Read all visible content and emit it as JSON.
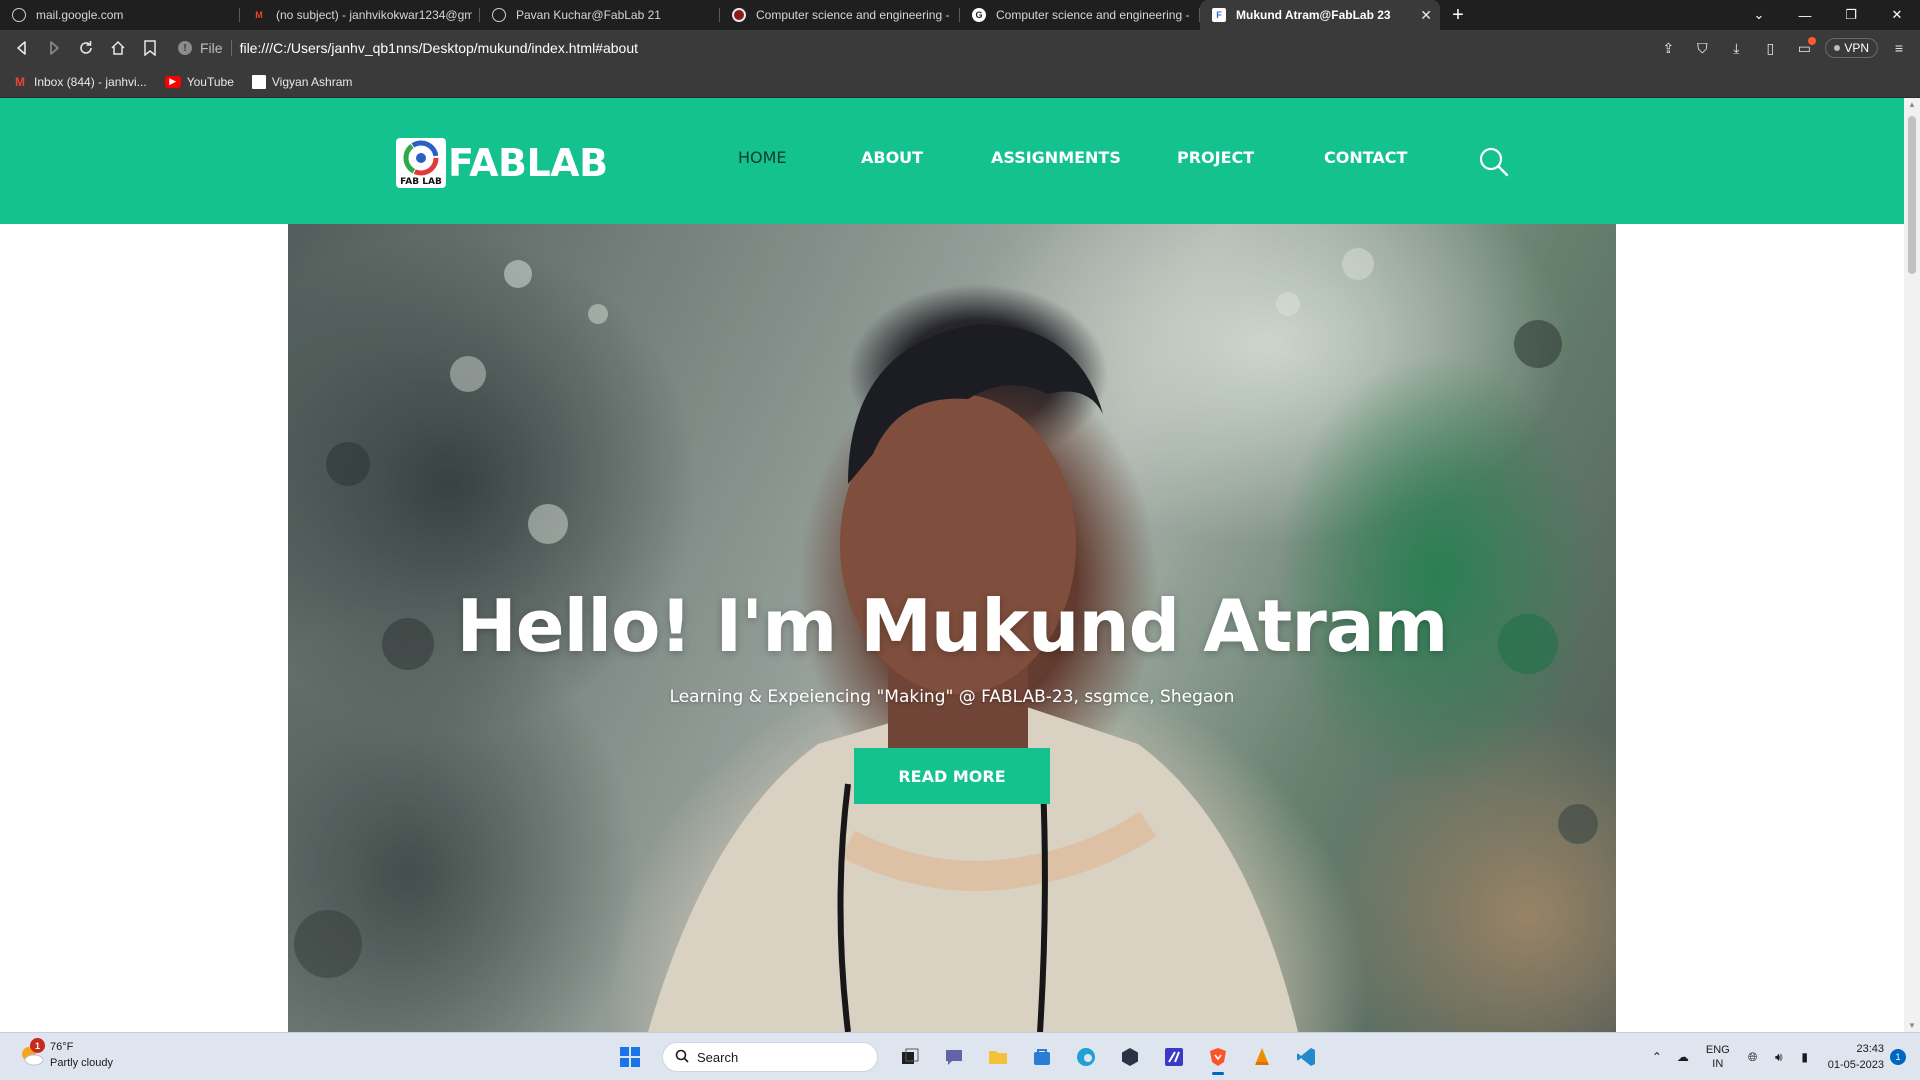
{
  "browser": {
    "tabs": [
      {
        "title": "mail.google.com",
        "icon": "globe-icon",
        "active": false
      },
      {
        "title": "(no subject) - janhvikokwar1234@gm",
        "icon": "gmail-icon",
        "active": false
      },
      {
        "title": "Pavan Kuchar@FabLab 21",
        "icon": "globe-icon",
        "active": false
      },
      {
        "title": "Computer science and engineering - E",
        "icon": "college-icon",
        "active": false
      },
      {
        "title": "Computer science and engineering - C",
        "icon": "google-icon",
        "active": false
      },
      {
        "title": "Mukund Atram@FabLab 23",
        "icon": "fablab-icon",
        "active": true
      }
    ],
    "new_tab": "+",
    "address": {
      "scheme": "File",
      "url": "file:///C:/Users/janhv_qb1nns/Desktop/mukund/index.html#about"
    },
    "vpn_label": "VPN",
    "bookmarks": [
      {
        "label": "Inbox (844) - janhvi...",
        "icon": "gmail-icon"
      },
      {
        "label": "YouTube",
        "icon": "youtube-icon"
      },
      {
        "label": "Vigyan Ashram",
        "icon": "page-icon"
      }
    ]
  },
  "site": {
    "logo_badge": "FAB LAB",
    "logo_text": "FABLAB",
    "nav": [
      {
        "label": "HOME",
        "current": true
      },
      {
        "label": "ABOUT",
        "current": false
      },
      {
        "label": "ASSIGNMENTS",
        "current": false
      },
      {
        "label": "PROJECT",
        "current": false
      },
      {
        "label": "CONTACT",
        "current": false
      }
    ],
    "hero": {
      "title": "Hello! I'm Mukund Atram",
      "subtitle": "Learning & Expeiencing \"Making\" @ FABLAB-23, ssgmce, Shegaon",
      "button": "READ MORE"
    },
    "accent_color": "#13c28f"
  },
  "taskbar": {
    "weather": {
      "badge": "1",
      "temp": "76°F",
      "condition": "Partly cloudy"
    },
    "search_placeholder": "Search",
    "lang": {
      "line1": "ENG",
      "line2": "IN"
    },
    "clock": {
      "time": "23:43",
      "date": "01-05-2023"
    },
    "notifications": "1"
  }
}
